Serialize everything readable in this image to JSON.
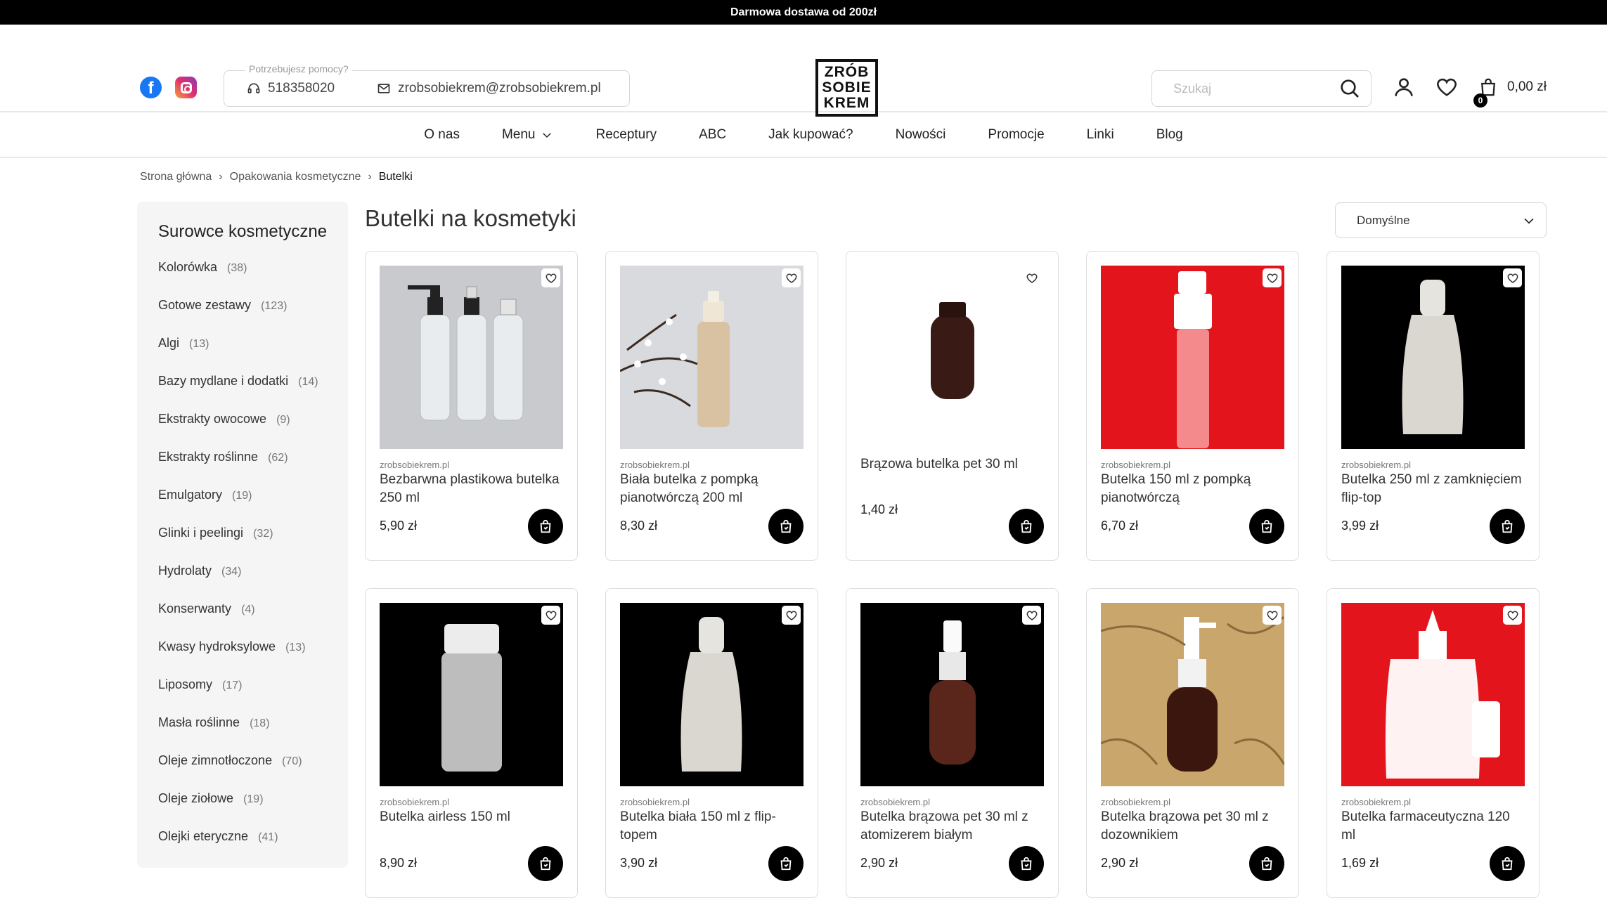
{
  "topbar": {
    "text": "Darmowa dostawa od 200zł"
  },
  "header": {
    "help_legend": "Potrzebujesz pomocy?",
    "phone": "518358020",
    "email": "zrobsobiekrem@zrobsobiekrem.pl",
    "logo_lines": [
      "ZRÓB",
      "SOBIE",
      "KREM"
    ],
    "search_placeholder": "Szukaj",
    "cart_count": "0",
    "cart_total": "0,00 zł"
  },
  "nav": [
    "O nas",
    "Menu",
    "Receptury",
    "ABC",
    "Jak kupować?",
    "Nowości",
    "Promocje",
    "Linki",
    "Blog"
  ],
  "breadcrumb": [
    "Strona główna",
    "Opakowania kosmetyczne",
    "Butelki"
  ],
  "sidebar": {
    "heading": "Surowce kosmetyczne",
    "categories": [
      {
        "name": "Kolorówka",
        "count": "(38)"
      },
      {
        "name": "Gotowe zestawy",
        "count": "(123)"
      },
      {
        "name": "Algi",
        "count": "(13)"
      },
      {
        "name": "Bazy mydlane i dodatki",
        "count": "(14)"
      },
      {
        "name": "Ekstrakty owocowe",
        "count": "(9)"
      },
      {
        "name": "Ekstrakty roślinne",
        "count": "(62)"
      },
      {
        "name": "Emulgatory",
        "count": "(19)"
      },
      {
        "name": "Glinki i peelingi",
        "count": "(32)"
      },
      {
        "name": "Hydrolaty",
        "count": "(34)"
      },
      {
        "name": "Konserwanty",
        "count": "(4)"
      },
      {
        "name": "Kwasy hydroksylowe",
        "count": "(13)"
      },
      {
        "name": "Liposomy",
        "count": "(17)"
      },
      {
        "name": "Masła roślinne",
        "count": "(18)"
      },
      {
        "name": "Oleje zimnotłoczone",
        "count": "(70)"
      },
      {
        "name": "Oleje ziołowe",
        "count": "(19)"
      },
      {
        "name": "Olejki eteryczne",
        "count": "(41)"
      }
    ]
  },
  "page_title": "Butelki na kosmetyki",
  "sort_value": "Domyślne",
  "brand": "zrobsobiekrem.pl",
  "products": [
    {
      "name": "Bezbarwna plastikowa butelka 250 ml",
      "price": "5,90 zł",
      "bg": "#c9cacd",
      "bottle": "clear"
    },
    {
      "name": "Biała butelka z pompką pianotwórczą 200 ml",
      "price": "8,30 zł",
      "bg": "#d9dadd",
      "bottle": "beige"
    },
    {
      "name": "Brązowa butelka pet 30 ml",
      "price": "1,40 zł",
      "bg": "#ffffff",
      "bottle": "brown"
    },
    {
      "name": "Butelka 150 ml z pompką pianotwórczą",
      "price": "6,70 zł",
      "bg": "#e3141b",
      "bottle": "white"
    },
    {
      "name": "Butelka 250 ml z zamknięciem flip-top",
      "price": "3,99 zł",
      "bg": "#000000",
      "bottle": "flip"
    },
    {
      "name": "Butelka airless 150 ml",
      "price": "8,90 zł",
      "bg": "#000000",
      "bottle": "airless"
    },
    {
      "name": "Butelka biała 150 ml z flip-topem",
      "price": "3,90 zł",
      "bg": "#000000",
      "bottle": "flip"
    },
    {
      "name": "Butelka brązowa pet 30 ml z atomizerem białym",
      "price": "2,90 zł",
      "bg": "#000000",
      "bottle": "brownspray"
    },
    {
      "name": "Butelka brązowa pet 30 ml z dozownikiem",
      "price": "2,90 zł",
      "bg": "#c9a66b",
      "bottle": "brownpump"
    },
    {
      "name": "Butelka farmaceutyczna 120 ml",
      "price": "1,69 zł",
      "bg": "#e3141b",
      "bottle": "pharma"
    }
  ]
}
